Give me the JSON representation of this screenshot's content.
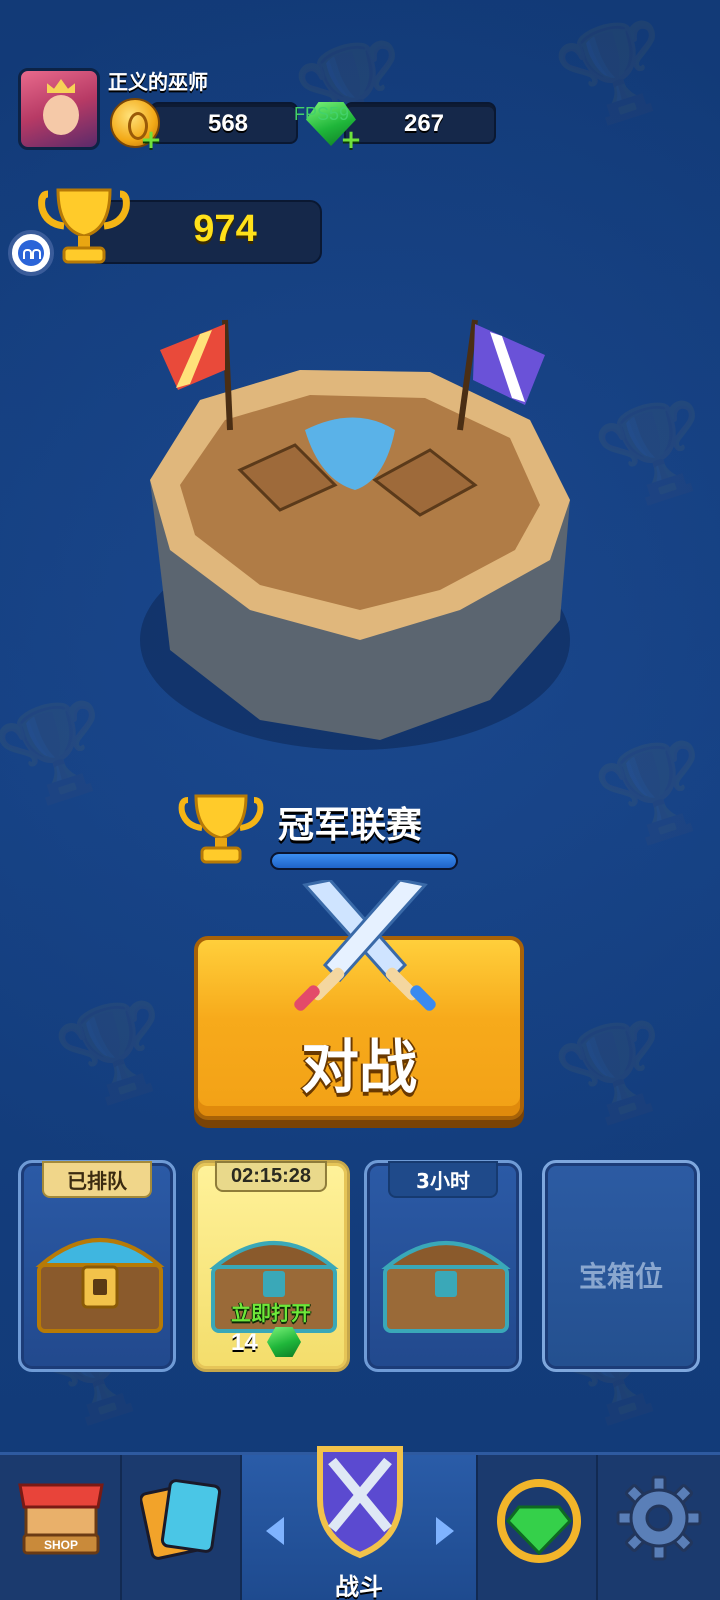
{
  "player": {
    "name": "正义的巫师"
  },
  "resources": {
    "gold": "568",
    "gems": "267",
    "fps": "FPS59"
  },
  "trophies": "974",
  "league": {
    "name": "冠军联赛",
    "progress": 1.0
  },
  "battle": {
    "label": "对战"
  },
  "chest_slots": [
    {
      "tag": "已排队",
      "state": "queued"
    },
    {
      "tag": "02:15:28",
      "state": "unlocking",
      "action": "立即打开",
      "cost": "14"
    },
    {
      "tag": "3小时",
      "state": "locked"
    },
    {
      "label": "宝箱位",
      "state": "empty"
    }
  ],
  "nav": {
    "shop_text": "SHOP",
    "battle_label": "战斗"
  },
  "colors": {
    "background": "#123a77",
    "battle_button": "#f7aa1b",
    "trophy_text": "#ffe11a",
    "gem_green": "#1fb63a",
    "open_now_green": "#6fe83a"
  }
}
